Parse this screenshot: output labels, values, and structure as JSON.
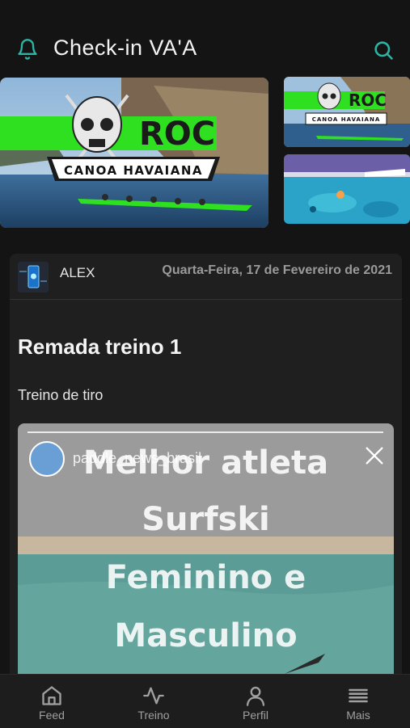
{
  "header": {
    "title": "Check-in VA'A",
    "bell_icon": "bell-icon",
    "search_icon": "search-icon",
    "accent": "#2bb5a4"
  },
  "banners": {
    "main": {
      "brand": "ROC",
      "subtitle": "CANOA HAVAIANA"
    },
    "thumb1": {
      "brand": "ROC",
      "subtitle": "CANOA HAVAIANA"
    }
  },
  "post": {
    "author": "ALEX",
    "date": "Quarta-Feira, 17 de Fevereiro de 2021",
    "title": "Remada treino 1",
    "subtitle": "Treino de tiro",
    "media": {
      "username": "paddle_news_brasil",
      "lines": [
        "Melhor atleta",
        "Surfski",
        "Feminino e",
        "Masculino"
      ]
    }
  },
  "tabs": [
    {
      "label": "Feed",
      "icon": "home-icon"
    },
    {
      "label": "Treino",
      "icon": "activity-icon"
    },
    {
      "label": "Perfil",
      "icon": "user-icon"
    },
    {
      "label": "Mais",
      "icon": "menu-icon"
    }
  ]
}
